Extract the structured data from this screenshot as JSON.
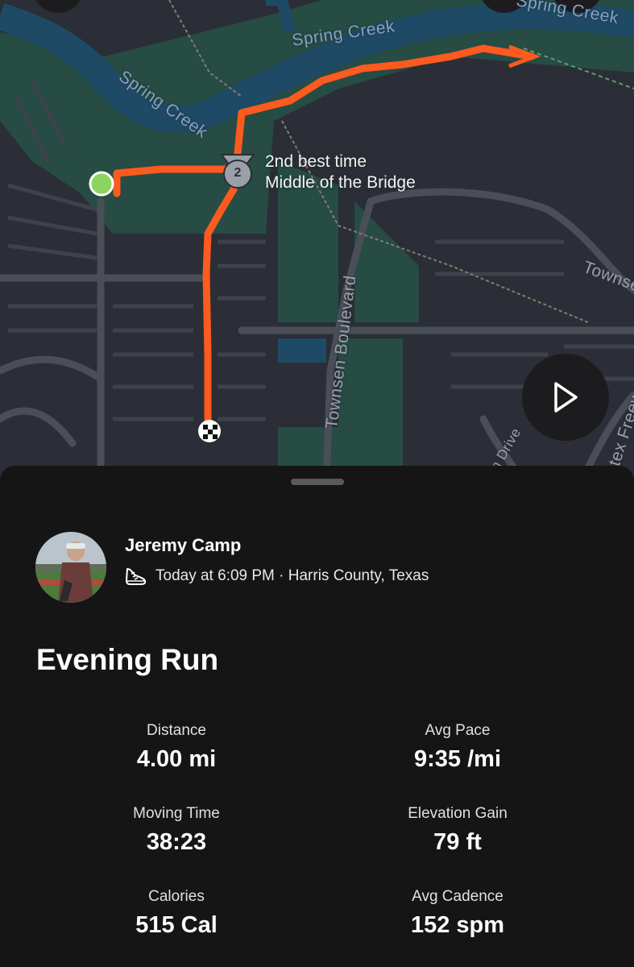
{
  "map": {
    "labels": {
      "creek_top": "Spring Creek",
      "creek_left": "Spring Creek",
      "creek_right": "Spring Creek",
      "boulevard": "Townsen Boulevard",
      "townsen_right": "Townsen",
      "drive": "on Drive",
      "freeway": "stex Freew"
    },
    "segment": {
      "rank": "2",
      "line1": "2nd best time",
      "line2": "Middle of the Bridge"
    },
    "colors": {
      "route": "#fc5a1f",
      "start": "#8dd35f",
      "water": "#1f4a66",
      "park": "#264c44",
      "road": "#4a4e57"
    }
  },
  "athlete": {
    "name": "Jeremy Camp",
    "meta": "Today at 6:09 PM · Harris County, Texas",
    "activity_icon": "running-shoe-icon"
  },
  "activity": {
    "title": "Evening Run",
    "stats": {
      "distance": {
        "label": "Distance",
        "value": "4.00 mi"
      },
      "avg_pace": {
        "label": "Avg Pace",
        "value": "9:35 /mi"
      },
      "moving_time": {
        "label": "Moving Time",
        "value": "38:23"
      },
      "elevation_gain": {
        "label": "Elevation Gain",
        "value": "79 ft"
      },
      "calories": {
        "label": "Calories",
        "value": "515 Cal"
      },
      "avg_cadence": {
        "label": "Avg Cadence",
        "value": "152 spm"
      }
    }
  }
}
